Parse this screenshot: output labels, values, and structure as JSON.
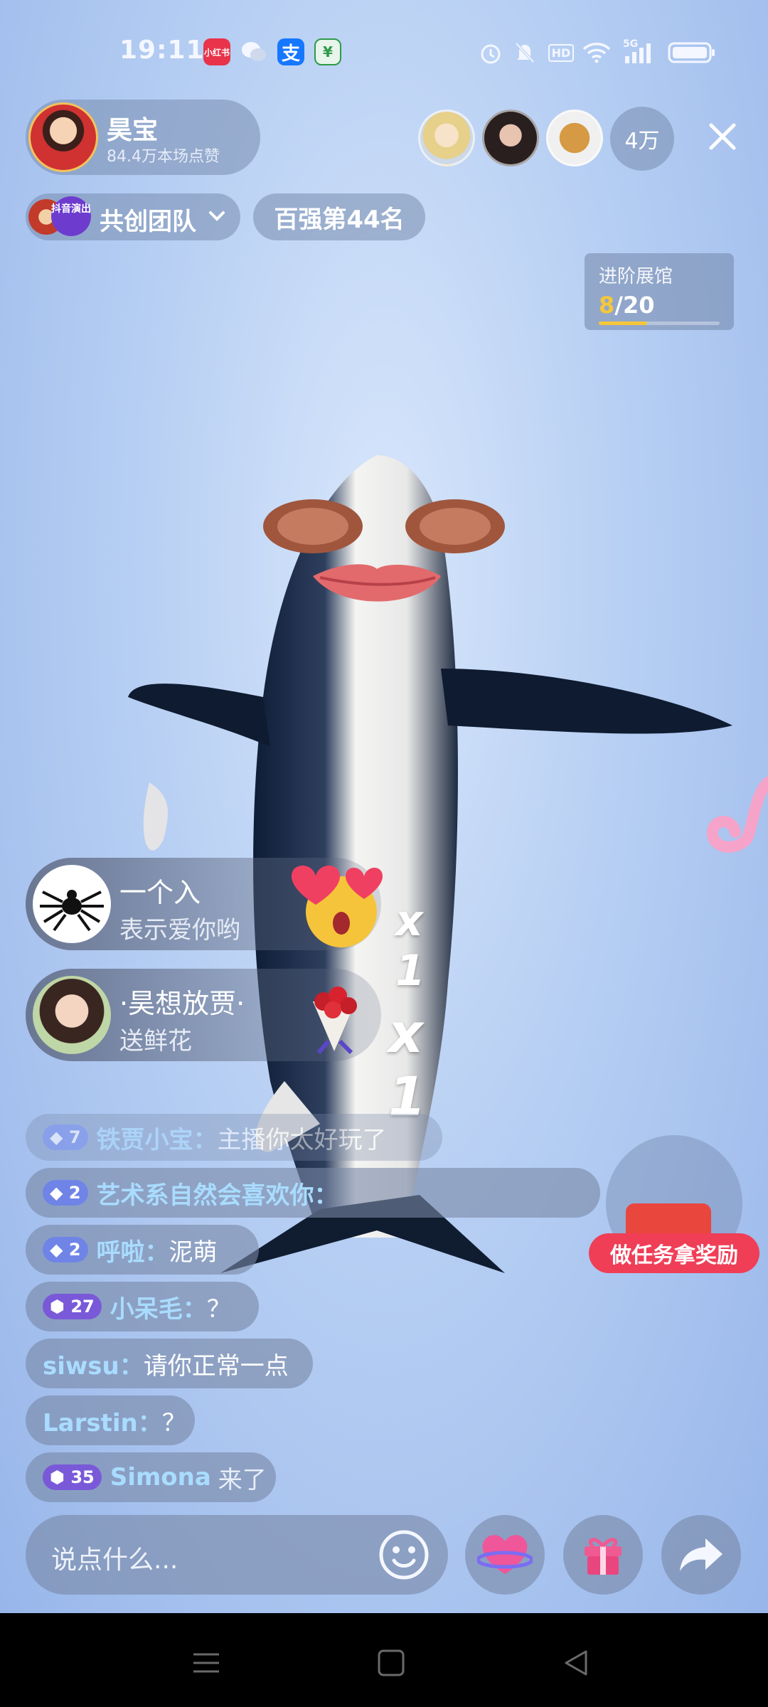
{
  "status_bar": {
    "time": "19:11",
    "network": "5G",
    "hd": "HD"
  },
  "host": {
    "name": "昊宝",
    "likes": "84.4万本场点赞"
  },
  "viewers": {
    "count_label": "4万"
  },
  "team": {
    "badge_text": "抖音演出",
    "label": "共创团队"
  },
  "rank": {
    "label": "百强第44名"
  },
  "exhibit": {
    "title": "进阶展馆",
    "current": "8",
    "total": "/20",
    "progress": 0.4
  },
  "gifts": [
    {
      "user": "一个入",
      "action": "表示爱你哟",
      "multiplier": "x 1"
    },
    {
      "user": "·昊想放贾·",
      "action": "送鲜花",
      "multiplier": "x 1"
    }
  ],
  "chat": [
    {
      "level": "7",
      "user": "铁贾小宝：",
      "message": "主播你太好玩了"
    },
    {
      "level": "2",
      "user": "艺术系自然会喜欢你：",
      "message": ""
    },
    {
      "level": "2",
      "user": "呼啦：",
      "message": "泥萌"
    },
    {
      "level": "27",
      "user": "小呆毛：",
      "message": "？"
    },
    {
      "level": "",
      "user": "siwsu：",
      "message": "请你正常一点"
    },
    {
      "level": "",
      "user": "Larstin：",
      "message": "？"
    },
    {
      "level": "35",
      "user": "Simona",
      "message": "来了"
    }
  ],
  "task": {
    "label": "做任务拿奖励"
  },
  "bottom": {
    "placeholder": "说点什么..."
  },
  "colors": {
    "accent_red": "#f03e57",
    "name_blue": "#a9dcff",
    "progress_yellow": "#f6c73a"
  }
}
